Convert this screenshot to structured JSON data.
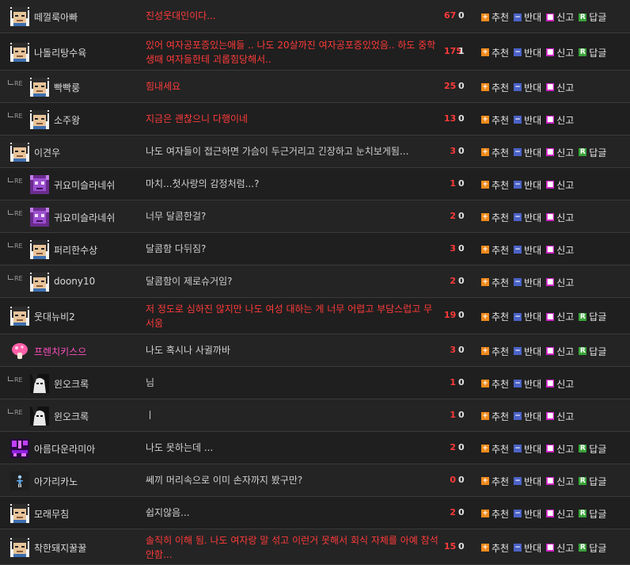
{
  "actions": {
    "recommend": "추천",
    "oppose": "반대",
    "report": "신고",
    "reply": "답글"
  },
  "reply_marker": "RE",
  "colors": {
    "hot_text": "#ff3a3a",
    "pink_name": "#ff4fc0",
    "recommend": "#f08a1c",
    "oppose": "#4b63c8",
    "report": "#d024c8",
    "reply": "#3aa33a"
  },
  "comments": [
    {
      "name": "떼껄룩아빠",
      "avatar": "pixel-face",
      "content": "진성웃대인이다...",
      "hot": true,
      "up": "67",
      "down": "0",
      "is_reply": false
    },
    {
      "name": "나돌리탕수육",
      "avatar": "pixel-face",
      "content": "있어 여자공포증있는애들 .. 나도 20살까진 여자공포증있었음.. 하도 중학생때 여자들한테 괴롭힘당해서..",
      "hot": true,
      "up": "175",
      "down": "1",
      "is_reply": false
    },
    {
      "name": "빡빡룽",
      "avatar": "pixel-face",
      "content": "힘내세요",
      "hot": true,
      "up": "25",
      "down": "0",
      "is_reply": true
    },
    {
      "name": "소주왕",
      "avatar": "pixel-face",
      "content": "지금은 괜찮으니 다행이네",
      "hot": true,
      "up": "13",
      "down": "0",
      "is_reply": true
    },
    {
      "name": "이견우",
      "avatar": "pixel-face",
      "content": "나도 여자들이 접근하면 가슴이 두근거리고 긴장하고 눈치보게됨...",
      "hot": false,
      "up": "3",
      "down": "0",
      "is_reply": false
    },
    {
      "name": "귀요미슬라네쉬",
      "avatar": "purple-creature",
      "content": "마치...첫사랑의 감정처럼...?",
      "hot": false,
      "up": "1",
      "down": "0",
      "is_reply": true
    },
    {
      "name": "귀요미슬라네쉬",
      "avatar": "purple-creature",
      "content": "너무 달콤한걸?",
      "hot": false,
      "up": "2",
      "down": "0",
      "is_reply": true
    },
    {
      "name": "퍼리한수상",
      "avatar": "pixel-face",
      "content": "달콤함 다뒤짐?",
      "hot": false,
      "up": "3",
      "down": "0",
      "is_reply": true
    },
    {
      "name": "doony10",
      "avatar": "pixel-face",
      "content": "달콤함이 제로슈거임?",
      "hot": false,
      "up": "2",
      "down": "0",
      "is_reply": true
    },
    {
      "name": "웃대뉴비2",
      "avatar": "pixel-face",
      "content": "저 정도로 심하진 않지만 나도 여성 대하는 게 너무 어렵고 부담스럽고 무서움",
      "hot": true,
      "up": "19",
      "down": "0",
      "is_reply": false
    },
    {
      "name": "프렌치키스으",
      "avatar": "pink-mushroom",
      "content": "나도 혹시나 사귈까바",
      "hot": false,
      "up": "3",
      "down": "0",
      "is_reply": false,
      "pink_name": true
    },
    {
      "name": "윈오크록",
      "avatar": "bw-face",
      "content": "님",
      "hot": false,
      "up": "1",
      "down": "0",
      "is_reply": true
    },
    {
      "name": "윈오크록",
      "avatar": "bw-face",
      "content": "ㅣ",
      "hot": false,
      "up": "1",
      "down": "0",
      "is_reply": true
    },
    {
      "name": "아름다운라미아",
      "avatar": "purple-pixel",
      "content": "나도 못하는데 ...",
      "hot": false,
      "up": "2",
      "down": "0",
      "is_reply": false
    },
    {
      "name": "아가리카노",
      "avatar": "tiny-figure",
      "content": "쎄끼 머리속으로 이미 손자까지 봤구만?",
      "hot": false,
      "up": "0",
      "down": "0",
      "is_reply": false
    },
    {
      "name": "모래무침",
      "avatar": "pixel-face",
      "content": "쉽지않음...",
      "hot": false,
      "up": "2",
      "down": "0",
      "is_reply": false
    },
    {
      "name": "착한돼지꿀꿀",
      "avatar": "pixel-face",
      "content": "솔직히 이해 됨. 나도 여자랑 말 섞고 이런거 못해서 회식 자체를 아예 참석 안함...",
      "hot": true,
      "up": "15",
      "down": "0",
      "is_reply": false
    }
  ]
}
